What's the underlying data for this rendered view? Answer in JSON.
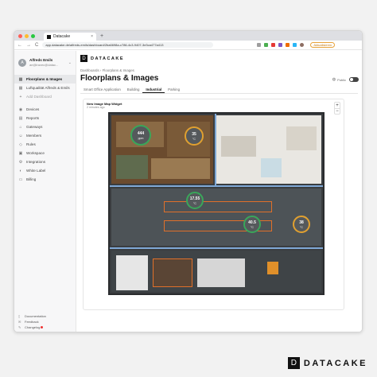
{
  "browser": {
    "tab_title": "Datacake",
    "tab_close": "×",
    "new_tab": "+",
    "nav_back": "←",
    "nav_forward": "→",
    "nav_reload": "C",
    "url": "app.datacake.de/alfreds-emils/dashboard/2ba6698a-c786-4c3-9407-3e3ca477a413",
    "update_label": "Aktualisieren",
    "traffic_colors": [
      "#ff5f57",
      "#febc2e",
      "#28c840"
    ]
  },
  "sidebar": {
    "user": {
      "initial": "A",
      "name": "Alfreds Emils",
      "email": "ae@iravec@datac...",
      "chevron": "⌄"
    },
    "dashboards": [
      {
        "label": "Floorplans & Images",
        "icon": "dashboard-icon",
        "glyph": "▦",
        "active": true
      },
      {
        "label": "Luftqualität Alfreds & Emils",
        "icon": "dashboard-icon",
        "glyph": "▦",
        "active": false
      },
      {
        "label": "Add Dashboard",
        "icon": "plus-icon",
        "glyph": "+",
        "active": false
      }
    ],
    "items": [
      {
        "label": "Devices",
        "icon": "devices-icon",
        "glyph": "◉"
      },
      {
        "label": "Reports",
        "icon": "reports-icon",
        "glyph": "▤"
      },
      {
        "label": "Gateways",
        "icon": "gateway-icon",
        "glyph": "⌂"
      },
      {
        "label": "Members",
        "icon": "members-icon",
        "glyph": "☺"
      },
      {
        "label": "Rules",
        "icon": "rules-icon",
        "glyph": "◇"
      },
      {
        "label": "Workspace",
        "icon": "workspace-icon",
        "glyph": "▣"
      },
      {
        "label": "Integrations",
        "icon": "integrations-icon",
        "glyph": "⚙"
      },
      {
        "label": "White Label",
        "icon": "white-label-icon",
        "glyph": "◐"
      },
      {
        "label": "Billing",
        "icon": "billing-icon",
        "glyph": "▭"
      }
    ],
    "footer": [
      {
        "label": "Documentation",
        "icon": "documentation-icon",
        "glyph": "▯"
      },
      {
        "label": "Feedback",
        "icon": "feedback-icon",
        "glyph": "✉"
      },
      {
        "label": "Changelog",
        "icon": "changelog-icon",
        "glyph": "✎"
      }
    ]
  },
  "brand": {
    "glyph": "D",
    "name": "DATACAKE"
  },
  "breadcrumb": {
    "text": "Dashboards  ›  Floorplans & Images"
  },
  "page": {
    "title": "Floorplans & Images",
    "public_label": "Public",
    "public_enabled": false,
    "tabs": [
      {
        "label": "Smart Office Application",
        "active": false
      },
      {
        "label": "Building",
        "active": false
      },
      {
        "label": "Industrial",
        "active": true
      },
      {
        "label": "Parking",
        "active": false
      }
    ]
  },
  "widget": {
    "title": "New Image Map Widget",
    "subtitle": "2 minutes ago",
    "zoom_in": "+",
    "zoom_out": "−",
    "sensors": [
      {
        "value": "444",
        "unit": "ppm",
        "ring": "#3aa65a"
      },
      {
        "value": "35",
        "unit": "°C",
        "ring": "#e0a030"
      },
      {
        "value": "17.55",
        "unit": "°C",
        "ring": "#3aa65a"
      },
      {
        "value": "40.5",
        "unit": "°C",
        "ring": "#3aa65a"
      },
      {
        "value": "38",
        "unit": "°C",
        "ring": "#e0a030"
      }
    ]
  },
  "watermark": {
    "glyph": "D",
    "name": "DATACAKE"
  }
}
